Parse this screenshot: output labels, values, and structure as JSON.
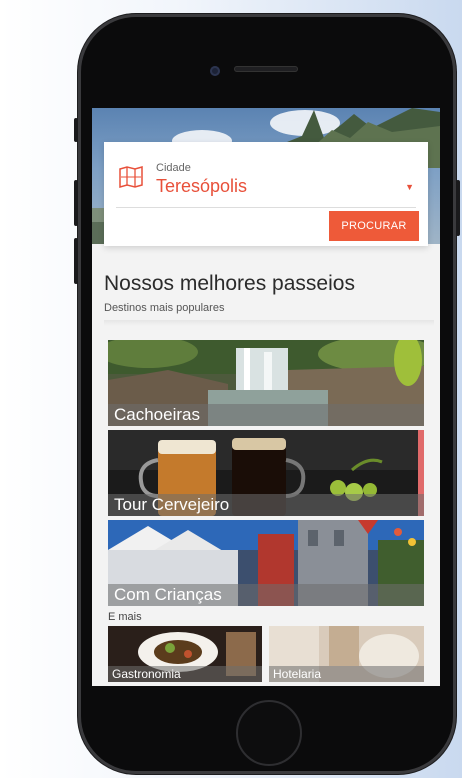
{
  "search": {
    "city_label": "Cidade",
    "city_value": "Teresópolis",
    "button_label": "PROCURAR"
  },
  "section": {
    "title": "Nossos melhores passeios",
    "subtitle": "Destinos mais populares"
  },
  "tours": [
    {
      "label": "Cachoeiras"
    },
    {
      "label": "Tour Cervejeiro"
    },
    {
      "label": "Com Crianças"
    }
  ],
  "more": {
    "label": "E mais",
    "items": [
      {
        "label": "Gastronomia"
      },
      {
        "label": "Hotelaria"
      }
    ]
  },
  "colors": {
    "accent": "#ee5a39",
    "city_text": "#e8503a"
  }
}
